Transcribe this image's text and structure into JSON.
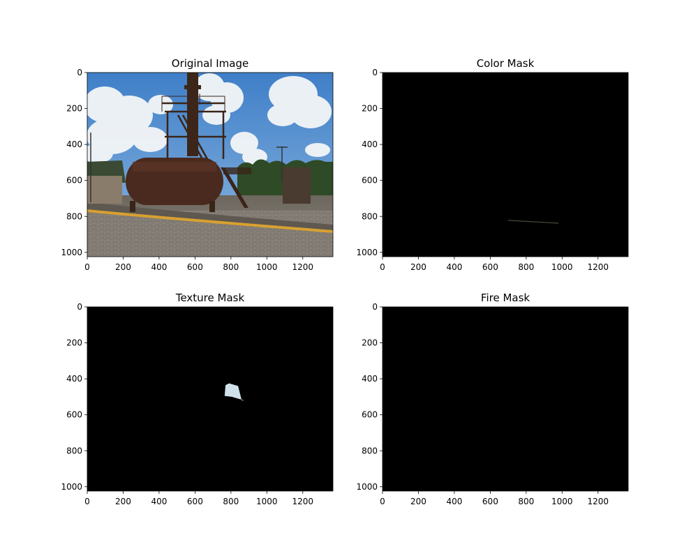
{
  "figure": {
    "background": "#ffffff"
  },
  "chart_data": [
    {
      "type": "image",
      "title": "Original Image",
      "xlabel": "",
      "ylabel": "",
      "image_size": [
        1368,
        1024
      ],
      "xlim": [
        0,
        1368
      ],
      "ylim": [
        1024,
        0
      ],
      "xticks": [
        0,
        200,
        400,
        600,
        800,
        1000,
        1200
      ],
      "yticks": [
        0,
        200,
        400,
        600,
        800,
        1000
      ],
      "content": "photo"
    },
    {
      "type": "image",
      "title": "Color Mask",
      "xlabel": "",
      "ylabel": "",
      "image_size": [
        1368,
        1024
      ],
      "xlim": [
        0,
        1368
      ],
      "ylim": [
        1024,
        0
      ],
      "xticks": [
        0,
        200,
        400,
        600,
        800,
        1000,
        1200
      ],
      "yticks": [
        0,
        200,
        400,
        600,
        800,
        1000
      ],
      "content": "mask",
      "mask_color": "#000000",
      "regions": [
        {
          "shape": "line",
          "points": [
            [
              700,
              822
            ],
            [
              980,
              838
            ]
          ],
          "color": "#4a4a3a"
        }
      ]
    },
    {
      "type": "image",
      "title": "Texture Mask",
      "xlabel": "",
      "ylabel": "",
      "image_size": [
        1368,
        1024
      ],
      "xlim": [
        0,
        1368
      ],
      "ylim": [
        1024,
        0
      ],
      "xticks": [
        0,
        200,
        400,
        600,
        800,
        1000,
        1200
      ],
      "yticks": [
        0,
        200,
        400,
        600,
        800,
        1000
      ],
      "content": "mask",
      "mask_color": "#000000",
      "regions": [
        {
          "shape": "polygon",
          "points": [
            [
              790,
              425
            ],
            [
              840,
              440
            ],
            [
              860,
              520
            ],
            [
              875,
              520
            ],
            [
              805,
              500
            ],
            [
              765,
              495
            ],
            [
              770,
              435
            ]
          ],
          "color": "#cfe2ec"
        }
      ]
    },
    {
      "type": "image",
      "title": "Fire Mask",
      "xlabel": "",
      "ylabel": "",
      "image_size": [
        1368,
        1024
      ],
      "xlim": [
        0,
        1368
      ],
      "ylim": [
        1024,
        0
      ],
      "xticks": [
        0,
        200,
        400,
        600,
        800,
        1000,
        1200
      ],
      "yticks": [
        0,
        200,
        400,
        600,
        800,
        1000
      ],
      "content": "mask",
      "mask_color": "#000000",
      "regions": []
    }
  ]
}
